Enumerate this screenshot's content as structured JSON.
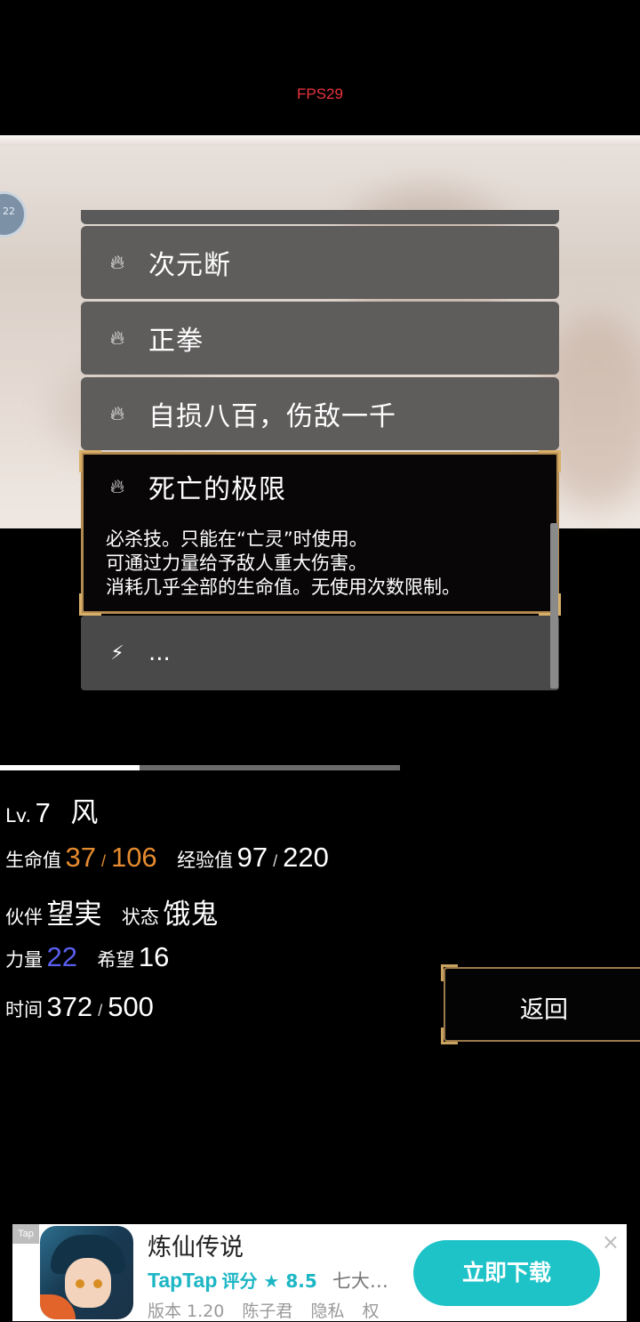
{
  "fps": "FPS29",
  "avatar_badge": "22",
  "skills": [
    {
      "icon": "flame-icon",
      "name": "次元断"
    },
    {
      "icon": "flame-icon",
      "name": "正拳"
    },
    {
      "icon": "flame-icon",
      "name": "自损八百，伤敌一千"
    }
  ],
  "selected_skill": {
    "icon": "flame-icon",
    "name": "死亡的极限",
    "desc": [
      "必杀技。只能在“亡灵”时使用。",
      "可通过力量给予敌人重大伤害。",
      "消耗几乎全部的生命值。无使用次数限制。"
    ]
  },
  "more_skill": {
    "icon": "lightning-icon",
    "name": "..."
  },
  "stats": {
    "lv_label": "Lv.",
    "lv": "7",
    "name": "风",
    "hp_label": "生命值",
    "hp": "37",
    "hp_max": "106",
    "exp_label": "经验值",
    "exp": "97",
    "exp_max": "220",
    "partner_label": "伙伴",
    "partner": "望実",
    "state_label": "状态",
    "state": "饿鬼",
    "power_label": "力量",
    "power": "22",
    "hope_label": "希望",
    "hope": "16",
    "time_label": "时间",
    "time": "372",
    "time_max": "500",
    "slash": "/"
  },
  "back_label": "返回",
  "ad": {
    "tag": "Tap",
    "title": "炼仙传说",
    "brand": "TapTap",
    "rating": "评分 ★ 8.5",
    "more": "七大…",
    "version": "版本 1.20",
    "developer": "陈子君",
    "privacy": "隐私",
    "extra": "权",
    "download": "立即下载",
    "close": "×"
  },
  "colors": {
    "accent_orange": "#e58b2f",
    "accent_blue": "#5a5ff0",
    "gold_frame": "#b38a4f",
    "ad_teal": "#1ec3c8"
  }
}
